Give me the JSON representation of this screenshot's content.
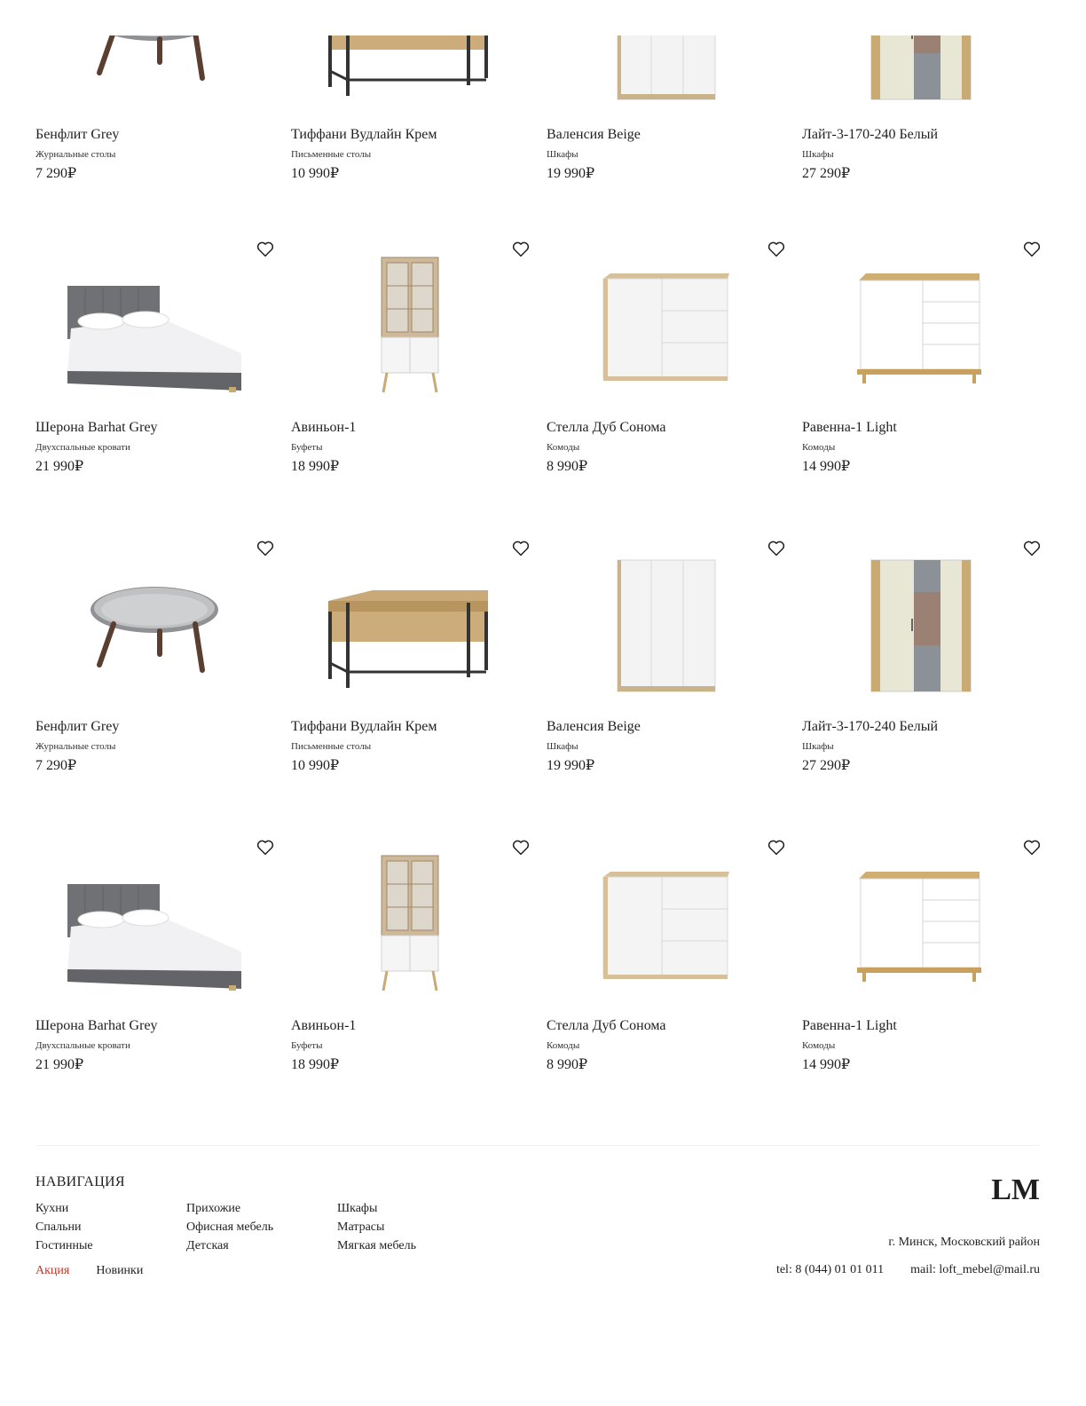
{
  "products": [
    {
      "name": "Бенфлит Grey",
      "category": "Журнальные столы",
      "price": "7 290₽",
      "icon": "coffee-table",
      "heart": false
    },
    {
      "name": "Тиффани Вудлайн Крем",
      "category": "Письменные столы",
      "price": "10 990₽",
      "icon": "desk",
      "heart": false
    },
    {
      "name": "Валенсия Beige",
      "category": "Шкафы",
      "price": "19 990₽",
      "icon": "wardrobe",
      "heart": false
    },
    {
      "name": "Лайт-3-170-240 Белый",
      "category": "Шкафы",
      "price": "27 290₽",
      "icon": "mirror-wardrobe",
      "heart": false
    },
    {
      "name": "Шерона Barhat Grey",
      "category": "Двухспальные кровати",
      "price": "21 990₽",
      "icon": "bed",
      "heart": true
    },
    {
      "name": "Авиньон-1",
      "category": "Буфеты",
      "price": "18 990₽",
      "icon": "cabinet",
      "heart": true
    },
    {
      "name": "Стелла Дуб Сонома",
      "category": "Комоды",
      "price": "8 990₽",
      "icon": "dresser",
      "heart": true
    },
    {
      "name": "Равенна-1 Light",
      "category": "Комоды",
      "price": "14 990₽",
      "icon": "sideboard",
      "heart": true
    },
    {
      "name": "Бенфлит Grey",
      "category": "Журнальные столы",
      "price": "7 290₽",
      "icon": "coffee-table",
      "heart": true
    },
    {
      "name": "Тиффани Вудлайн Крем",
      "category": "Письменные столы",
      "price": "10 990₽",
      "icon": "desk",
      "heart": true
    },
    {
      "name": "Валенсия Beige",
      "category": "Шкафы",
      "price": "19 990₽",
      "icon": "wardrobe",
      "heart": true
    },
    {
      "name": "Лайт-3-170-240 Белый",
      "category": "Шкафы",
      "price": "27 290₽",
      "icon": "mirror-wardrobe",
      "heart": true
    },
    {
      "name": "Шерона Barhat Grey",
      "category": "Двухспальные кровати",
      "price": "21 990₽",
      "icon": "bed",
      "heart": true
    },
    {
      "name": "Авиньон-1",
      "category": "Буфеты",
      "price": "18 990₽",
      "icon": "cabinet",
      "heart": true
    },
    {
      "name": "Стелла Дуб Сонома",
      "category": "Комоды",
      "price": "8 990₽",
      "icon": "dresser",
      "heart": true
    },
    {
      "name": "Равенна-1 Light",
      "category": "Комоды",
      "price": "14 990₽",
      "icon": "sideboard",
      "heart": true
    }
  ],
  "footer": {
    "nav_title": "НАВИГАЦИЯ",
    "nav_columns": [
      [
        "Кухни",
        "Спальни",
        "Гостинные"
      ],
      [
        "Прихожие",
        "Офисная мебель",
        "Детская"
      ],
      [
        "Шкафы",
        "Матрасы",
        "Мягкая мебель"
      ]
    ],
    "promo": "Акция",
    "new": "Новинки",
    "logo": "LM",
    "address": "г. Минск, Московский район",
    "tel": "tel: 8 (044) 01 01 011",
    "mail": "mail: loft_mebel@mail.ru"
  },
  "colors": {
    "promo": "#c0392b",
    "text": "#1f1f1f"
  }
}
